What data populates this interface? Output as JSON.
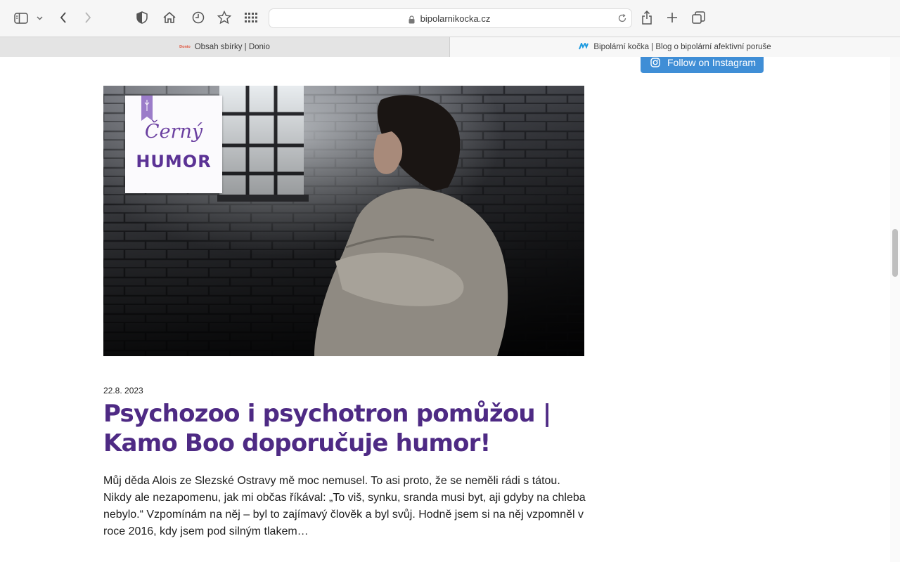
{
  "browser": {
    "url": "bipolarnikocka.cz",
    "tabs": [
      {
        "title": "Obsah sbírky | Donio",
        "favicon": "Donio",
        "active": false
      },
      {
        "title": "Bipolární kočka | Blog o bipolární afektivní poruše",
        "favicon": "bk-logo",
        "active": true
      }
    ],
    "icons": [
      "sidebar-icon",
      "chevron-down-icon",
      "back-icon",
      "forward-icon",
      "shield-icon",
      "home-icon",
      "history-icon",
      "star-icon",
      "grid-icon",
      "lock-icon",
      "reload-icon",
      "share-icon",
      "plus-icon",
      "tabs-overview-icon"
    ]
  },
  "sidebar": {
    "instagram_label": "Follow on Instagram",
    "instagram_color": "#3f8ed6"
  },
  "post": {
    "image_tag_line1": "Černý",
    "image_tag_line2": "HUMOR",
    "date": "22.8. 2023",
    "title": "Psychozoo i psychotron pomůžou | Kamo Boo doporučuje humor!",
    "excerpt": "Můj děda Alois ze Slezské Ostravy mě moc nemusel. To asi proto, že se neměli rádi s tátou. Nikdy ale nezapomenu, jak mi občas říkával: „To viš, synku, sranda musi byt, aji gdyby na chleba nebylo.“ Vzpomínám na něj – byl to zajímavý člověk a byl svůj. Hodně jsem si na něj vzpomněl v roce 2016, kdy jsem pod silným tlakem…",
    "title_color": "#4e2a84"
  }
}
